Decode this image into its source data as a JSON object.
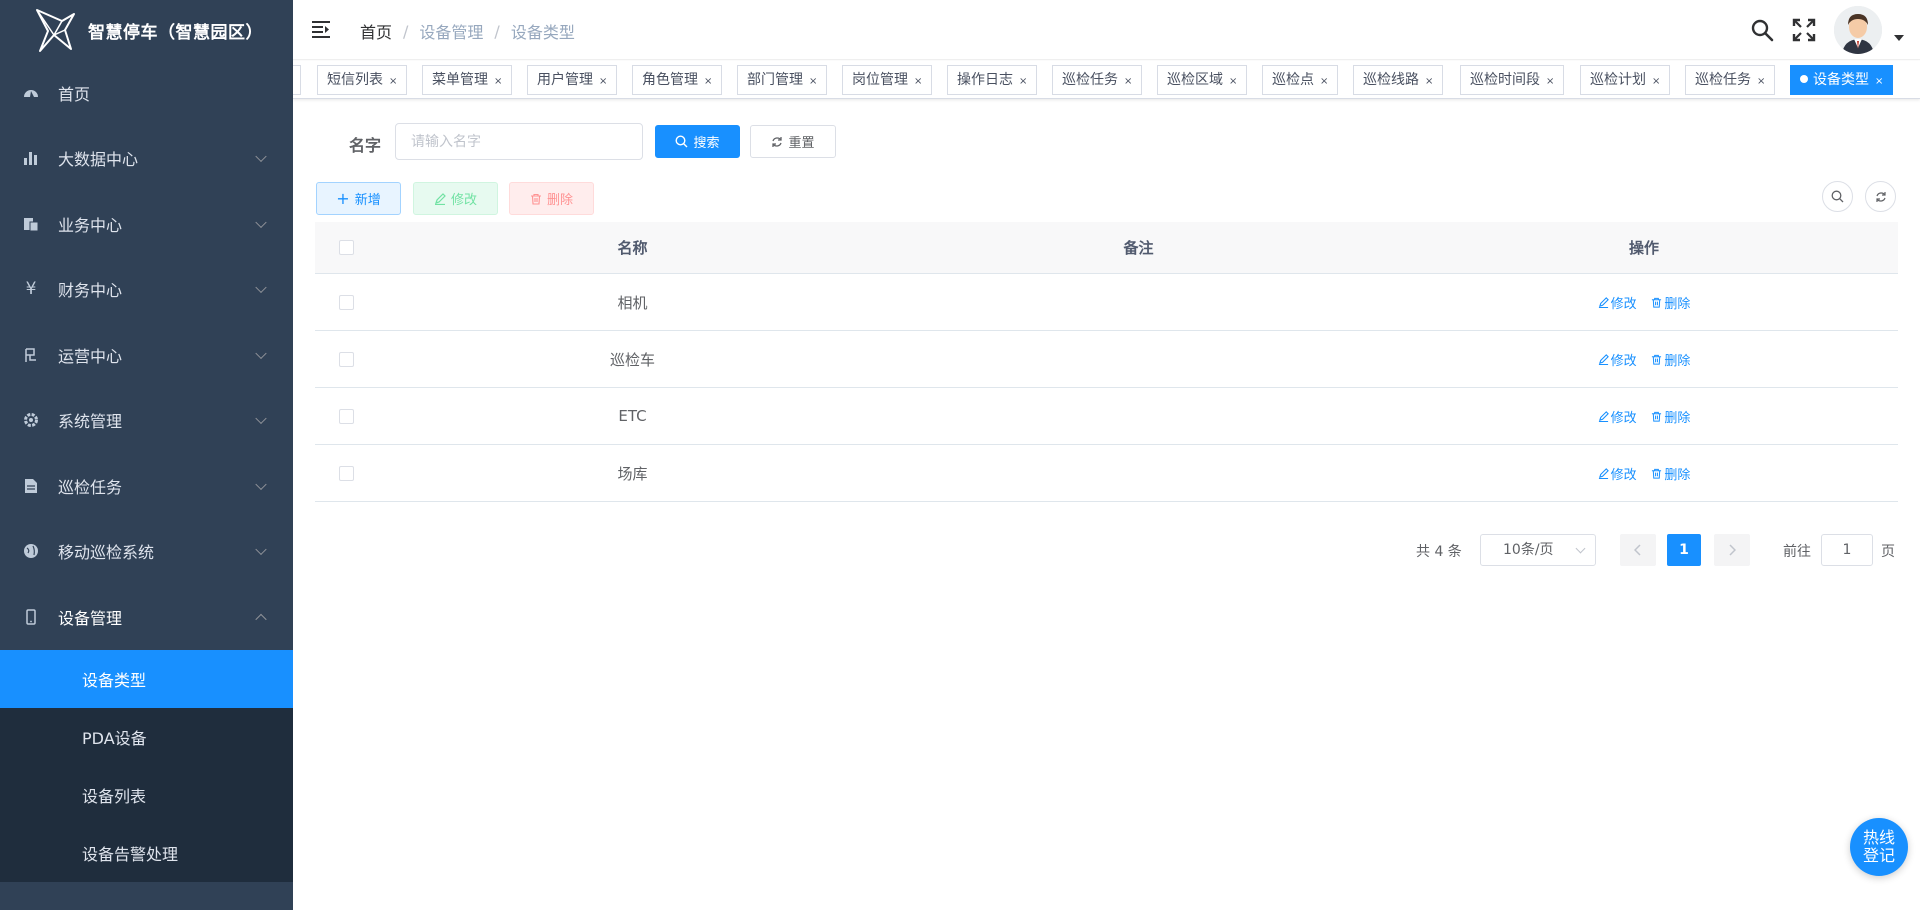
{
  "app": {
    "title": "智慧停车（智慧园区）"
  },
  "sidebar": {
    "items": [
      {
        "label": "首页",
        "icon": "dashboard-icon"
      },
      {
        "label": "大数据中心",
        "icon": "chart-icon"
      },
      {
        "label": "业务中心",
        "icon": "documents-icon"
      },
      {
        "label": "财务中心",
        "icon": "yuan-icon"
      },
      {
        "label": "运营中心",
        "icon": "flag-icon"
      },
      {
        "label": "系统管理",
        "icon": "gear-icon"
      },
      {
        "label": "巡检任务",
        "icon": "file-icon"
      },
      {
        "label": "移动巡检系统",
        "icon": "globe-icon"
      },
      {
        "label": "设备管理",
        "icon": "phone-icon"
      }
    ],
    "submenu": [
      {
        "label": "设备类型",
        "active": true
      },
      {
        "label": "PDA设备"
      },
      {
        "label": "设备列表"
      },
      {
        "label": "设备告警处理"
      }
    ]
  },
  "breadcrumb": {
    "home": "首页",
    "parent": "设备管理",
    "current": "设备类型"
  },
  "tags": [
    "短信列表",
    "菜单管理",
    "用户管理",
    "角色管理",
    "部门管理",
    "岗位管理",
    "操作日志",
    "巡检任务",
    "巡检区域",
    "巡检点",
    "巡检线路",
    "巡检时间段",
    "巡检计划",
    "巡检任务",
    "设备类型"
  ],
  "tags_close_glyph": "×",
  "search": {
    "label": "名字",
    "placeholder": "请输入名字",
    "search_button": "搜索",
    "reset_button": "重置"
  },
  "toolbar": {
    "add": "新增",
    "edit": "修改",
    "delete": "删除"
  },
  "table": {
    "columns": [
      "名称",
      "备注",
      "操作"
    ],
    "rows": [
      {
        "name": "相机",
        "remark": ""
      },
      {
        "name": "巡检车",
        "remark": ""
      },
      {
        "name": "ETC",
        "remark": ""
      },
      {
        "name": "场库",
        "remark": ""
      }
    ],
    "op_edit": "修改",
    "op_delete": "删除"
  },
  "pagination": {
    "total": "共 4 条",
    "page_size": "10条/页",
    "current_page": "1",
    "goto_label": "前往",
    "goto_value": "1",
    "page_suffix": "页"
  },
  "hotline": {
    "line1": "热线",
    "line2": "登记"
  },
  "colors": {
    "sidebar": "#304156",
    "primary": "#1890ff"
  }
}
